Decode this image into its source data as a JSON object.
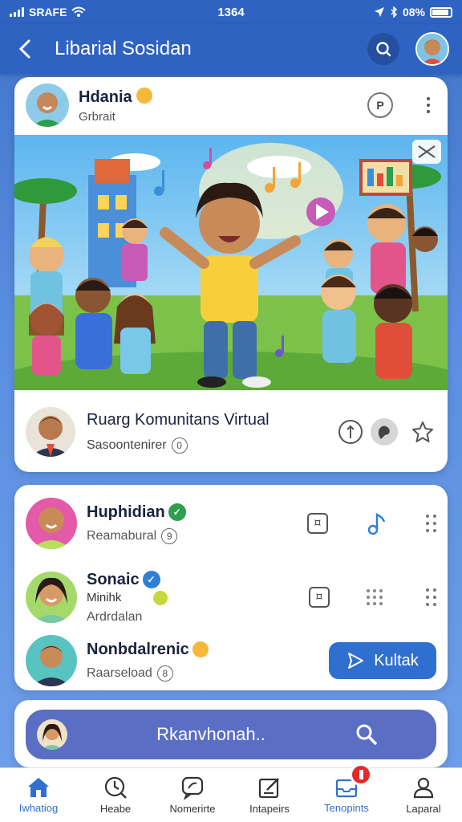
{
  "status_bar": {
    "carrier": "SRAFE",
    "time": "1364",
    "battery": "08%"
  },
  "header": {
    "title": "Libarial Sosidan"
  },
  "post": {
    "author_name": "Hdania",
    "author_sub": "Grbrait",
    "more_label": "P",
    "footer_title": "Ruarg Komunitans Virtual",
    "footer_sub": "Sasoontenirer",
    "footer_count": "0"
  },
  "contacts": [
    {
      "name": "Huphidian",
      "sub": "Reamabural",
      "count": "9",
      "verified_color": "#2e9e4f"
    },
    {
      "name": "Sonaic",
      "sub_extra": "Minihk",
      "sub": "Ardrdalan",
      "verified_color": "#2f7fd8"
    },
    {
      "name": "Nonbdalrenic",
      "sub": "Raarseload",
      "count": "8"
    }
  ],
  "chat_button": {
    "label": "Kultak"
  },
  "search": {
    "placeholder": "Rkanvhonah.."
  },
  "nav": [
    {
      "label": "Iwhatiog",
      "icon": "home-icon",
      "active": true
    },
    {
      "label": "Heabe",
      "icon": "clock-icon"
    },
    {
      "label": "Nomerirte",
      "icon": "chat-icon"
    },
    {
      "label": "Intapeirs",
      "icon": "edit-icon"
    },
    {
      "label": "Tenopints",
      "icon": "inbox-icon",
      "active": true
    },
    {
      "label": "Laparal",
      "icon": "profile-icon"
    }
  ],
  "colors": {
    "primary": "#2f63c2",
    "accent": "#2f6fcf",
    "badge": "#e02b2b"
  }
}
